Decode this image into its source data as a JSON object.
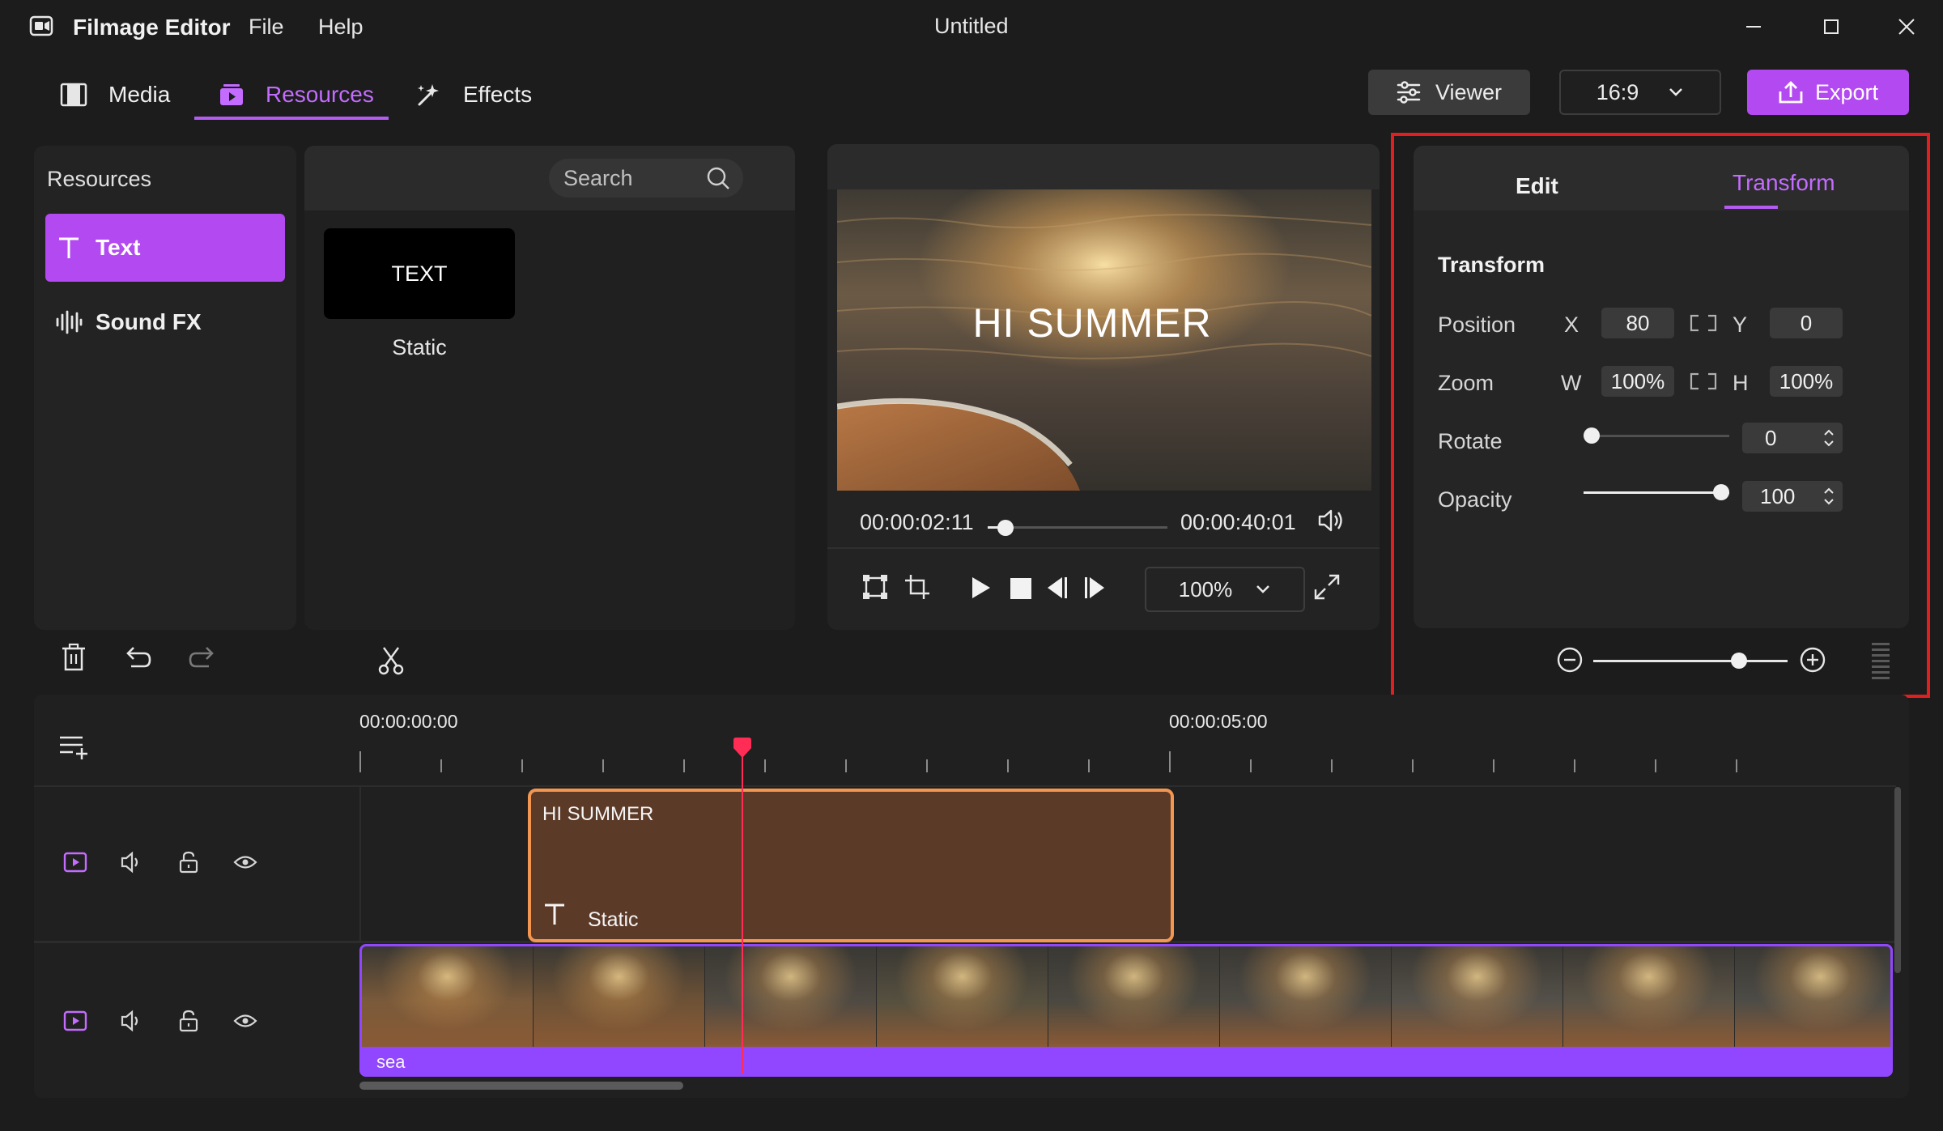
{
  "window": {
    "app_name": "Filmage Editor",
    "menu": [
      "File",
      "Help"
    ],
    "document_title": "Untitled"
  },
  "nav": {
    "tabs": [
      {
        "label": "Media",
        "icon": "film-icon"
      },
      {
        "label": "Resources",
        "icon": "resources-play-icon",
        "active": true
      },
      {
        "label": "Effects",
        "icon": "magic-wand-icon"
      }
    ],
    "viewer_label": "Viewer",
    "aspect_ratio": "16:9",
    "export_label": "Export"
  },
  "resources": {
    "header": "Resources",
    "items": [
      {
        "label": "Text",
        "icon": "text-t-icon",
        "active": true
      },
      {
        "label": "Sound FX",
        "icon": "waveform-icon"
      }
    ],
    "search_placeholder": "Search",
    "tiles": [
      {
        "thumb_text": "TEXT",
        "label": "Static"
      }
    ]
  },
  "preview": {
    "overlay_text": "HI SUMMER",
    "current_time": "00:00:02:11",
    "total_time": "00:00:40:01",
    "progress_fraction": 0.1,
    "zoom": "100%"
  },
  "inspector": {
    "tabs": [
      "Edit",
      "Transform"
    ],
    "active_tab": "Transform",
    "section_title": "Transform",
    "position": {
      "label": "Position",
      "x_axis": "X",
      "x": "80",
      "y_axis": "Y",
      "y": "0"
    },
    "zoom": {
      "label": "Zoom",
      "w_axis": "W",
      "w": "100%",
      "h_axis": "H",
      "h": "100%"
    },
    "rotate": {
      "label": "Rotate",
      "value": "0",
      "slider_fraction": 0.0
    },
    "opacity": {
      "label": "Opacity",
      "value": "100",
      "slider_fraction": 1.0
    },
    "timeline_zoom_fraction": 0.75,
    "highlight_color": "#e02020"
  },
  "timeline": {
    "time_marks": [
      "00:00:00:00",
      "00:00:05:00"
    ],
    "text_clip": {
      "title": "HI SUMMER",
      "type_label": "Static"
    },
    "video_clip": {
      "name": "sea"
    }
  },
  "colors": {
    "accent": "#b349f0",
    "text_clip_fill": "#5c3a28",
    "text_clip_border": "#f29650",
    "video_clip_bar": "#9147ff",
    "playhead": "#ff2d55"
  }
}
